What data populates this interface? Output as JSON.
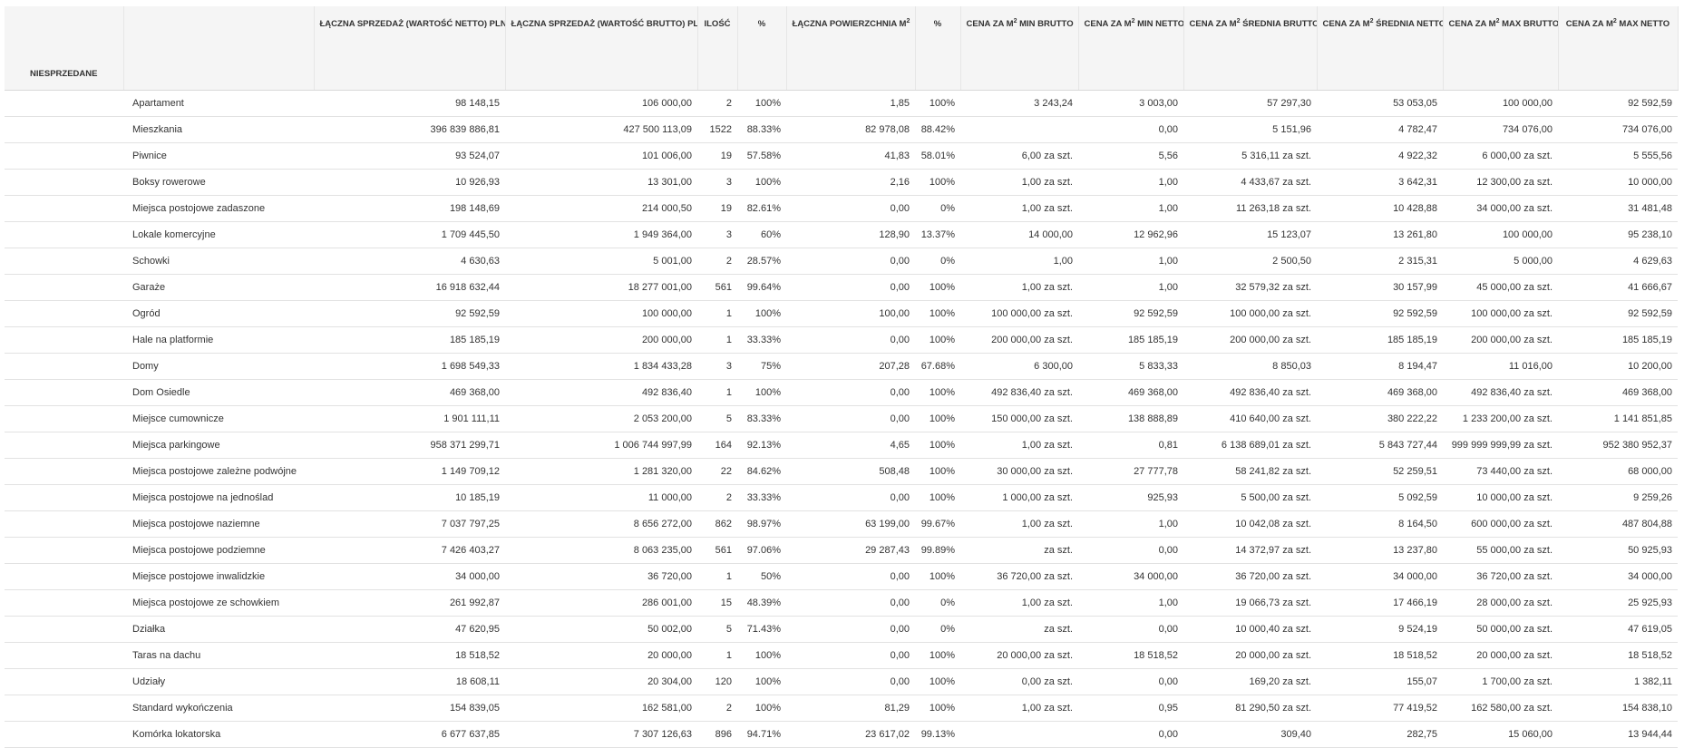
{
  "header": {
    "first": "NIESPRZEDANE",
    "cols": [
      {
        "pre": "ŁĄCZNA SPRZEDAŻ (WARTOŚĆ NETTO) PLN",
        "sup": "",
        "post": ""
      },
      {
        "pre": "ŁĄCZNA SPRZEDAŻ (WARTOŚĆ BRUTTO) PLN",
        "sup": "",
        "post": ""
      },
      {
        "pre": "ILOŚĆ",
        "sup": "",
        "post": ""
      },
      {
        "pre": "%",
        "sup": "",
        "post": ""
      },
      {
        "pre": "ŁĄCZNA POWIERZCHNIA M",
        "sup": "2",
        "post": ""
      },
      {
        "pre": "%",
        "sup": "",
        "post": ""
      },
      {
        "pre": "CENA ZA M",
        "sup": "2",
        "post": " MIN BRUTTO"
      },
      {
        "pre": "CENA ZA M",
        "sup": "2",
        "post": " MIN NETTO"
      },
      {
        "pre": "CENA ZA M",
        "sup": "2",
        "post": " ŚREDNIA BRUTTO"
      },
      {
        "pre": "CENA ZA M",
        "sup": "2",
        "post": " ŚREDNIA NETTO"
      },
      {
        "pre": "CENA ZA M",
        "sup": "2",
        "post": " MAX BRUTTO"
      },
      {
        "pre": "CENA ZA M",
        "sup": "2",
        "post": " MAX NETTO"
      }
    ]
  },
  "rows": [
    [
      "",
      "Apartament",
      "98 148,15",
      "106 000,00",
      "2",
      "100%",
      "1,85",
      "100%",
      "3 243,24",
      "3 003,00",
      "57 297,30",
      "53 053,05",
      "100 000,00",
      "92 592,59"
    ],
    [
      "",
      "Mieszkania",
      "396 839 886,81",
      "427 500 113,09",
      "1522",
      "88.33%",
      "82 978,08",
      "88.42%",
      "",
      "0,00",
      "5 151,96",
      "4 782,47",
      "734 076,00",
      "734 076,00"
    ],
    [
      "",
      "Piwnice",
      "93 524,07",
      "101 006,00",
      "19",
      "57.58%",
      "41,83",
      "58.01%",
      "6,00 za szt.",
      "5,56",
      "5 316,11 za szt.",
      "4 922,32",
      "6 000,00 za szt.",
      "5 555,56"
    ],
    [
      "",
      "Boksy rowerowe",
      "10 926,93",
      "13 301,00",
      "3",
      "100%",
      "2,16",
      "100%",
      "1,00 za szt.",
      "1,00",
      "4 433,67 za szt.",
      "3 642,31",
      "12 300,00 za szt.",
      "10 000,00"
    ],
    [
      "",
      "Miejsca postojowe zadaszone",
      "198 148,69",
      "214 000,50",
      "19",
      "82.61%",
      "0,00",
      "0%",
      "1,00 za szt.",
      "1,00",
      "11 263,18 za szt.",
      "10 428,88",
      "34 000,00 za szt.",
      "31 481,48"
    ],
    [
      "",
      "Lokale komercyjne",
      "1 709 445,50",
      "1 949 364,00",
      "3",
      "60%",
      "128,90",
      "13.37%",
      "14 000,00",
      "12 962,96",
      "15 123,07",
      "13 261,80",
      "100 000,00",
      "95 238,10"
    ],
    [
      "",
      "Schowki",
      "4 630,63",
      "5 001,00",
      "2",
      "28.57%",
      "0,00",
      "0%",
      "1,00",
      "1,00",
      "2 500,50",
      "2 315,31",
      "5 000,00",
      "4 629,63"
    ],
    [
      "",
      "Garaże",
      "16 918 632,44",
      "18 277 001,00",
      "561",
      "99.64%",
      "0,00",
      "100%",
      "1,00 za szt.",
      "1,00",
      "32 579,32 za szt.",
      "30 157,99",
      "45 000,00 za szt.",
      "41 666,67"
    ],
    [
      "",
      "Ogród",
      "92 592,59",
      "100 000,00",
      "1",
      "100%",
      "100,00",
      "100%",
      "100 000,00 za szt.",
      "92 592,59",
      "100 000,00 za szt.",
      "92 592,59",
      "100 000,00 za szt.",
      "92 592,59"
    ],
    [
      "",
      "Hale na platformie",
      "185 185,19",
      "200 000,00",
      "1",
      "33.33%",
      "0,00",
      "100%",
      "200 000,00 za szt.",
      "185 185,19",
      "200 000,00 za szt.",
      "185 185,19",
      "200 000,00 za szt.",
      "185 185,19"
    ],
    [
      "",
      "Domy",
      "1 698 549,33",
      "1 834 433,28",
      "3",
      "75%",
      "207,28",
      "67.68%",
      "6 300,00",
      "5 833,33",
      "8 850,03",
      "8 194,47",
      "11 016,00",
      "10 200,00"
    ],
    [
      "",
      "Dom Osiedle",
      "469 368,00",
      "492 836,40",
      "1",
      "100%",
      "0,00",
      "100%",
      "492 836,40 za szt.",
      "469 368,00",
      "492 836,40 za szt.",
      "469 368,00",
      "492 836,40 za szt.",
      "469 368,00"
    ],
    [
      "",
      "Miejsce cumownicze",
      "1 901 111,11",
      "2 053 200,00",
      "5",
      "83.33%",
      "0,00",
      "100%",
      "150 000,00 za szt.",
      "138 888,89",
      "410 640,00 za szt.",
      "380 222,22",
      "1 233 200,00 za szt.",
      "1 141 851,85"
    ],
    [
      "",
      "Miejsca parkingowe",
      "958 371 299,71",
      "1 006 744 997,99",
      "164",
      "92.13%",
      "4,65",
      "100%",
      "1,00 za szt.",
      "0,81",
      "6 138 689,01 za szt.",
      "5 843 727,44",
      "999 999 999,99 za szt.",
      "952 380 952,37"
    ],
    [
      "",
      "Miejsca postojowe zależne podwójne",
      "1 149 709,12",
      "1 281 320,00",
      "22",
      "84.62%",
      "508,48",
      "100%",
      "30 000,00 za szt.",
      "27 777,78",
      "58 241,82 za szt.",
      "52 259,51",
      "73 440,00 za szt.",
      "68 000,00"
    ],
    [
      "",
      "Miejsca postojowe na jednoślad",
      "10 185,19",
      "11 000,00",
      "2",
      "33.33%",
      "0,00",
      "100%",
      "1 000,00 za szt.",
      "925,93",
      "5 500,00 za szt.",
      "5 092,59",
      "10 000,00 za szt.",
      "9 259,26"
    ],
    [
      "",
      "Miejsca postojowe naziemne",
      "7 037 797,25",
      "8 656 272,00",
      "862",
      "98.97%",
      "63 199,00",
      "99.67%",
      "1,00 za szt.",
      "1,00",
      "10 042,08 za szt.",
      "8 164,50",
      "600 000,00 za szt.",
      "487 804,88"
    ],
    [
      "",
      "Miejsca postojowe podziemne",
      "7 426 403,27",
      "8 063 235,00",
      "561",
      "97.06%",
      "29 287,43",
      "99.89%",
      "za szt.",
      "0,00",
      "14 372,97 za szt.",
      "13 237,80",
      "55 000,00 za szt.",
      "50 925,93"
    ],
    [
      "",
      "Miejsce postojowe inwalidzkie",
      "34 000,00",
      "36 720,00",
      "1",
      "50%",
      "0,00",
      "100%",
      "36 720,00 za szt.",
      "34 000,00",
      "36 720,00 za szt.",
      "34 000,00",
      "36 720,00 za szt.",
      "34 000,00"
    ],
    [
      "",
      "Miejsca postojowe ze schowkiem",
      "261 992,87",
      "286 001,00",
      "15",
      "48.39%",
      "0,00",
      "0%",
      "1,00 za szt.",
      "1,00",
      "19 066,73 za szt.",
      "17 466,19",
      "28 000,00 za szt.",
      "25 925,93"
    ],
    [
      "",
      "Działka",
      "47 620,95",
      "50 002,00",
      "5",
      "71.43%",
      "0,00",
      "0%",
      "za szt.",
      "0,00",
      "10 000,40 za szt.",
      "9 524,19",
      "50 000,00 za szt.",
      "47 619,05"
    ],
    [
      "",
      "Taras na dachu",
      "18 518,52",
      "20 000,00",
      "1",
      "100%",
      "0,00",
      "100%",
      "20 000,00 za szt.",
      "18 518,52",
      "20 000,00 za szt.",
      "18 518,52",
      "20 000,00 za szt.",
      "18 518,52"
    ],
    [
      "",
      "Udziały",
      "18 608,11",
      "20 304,00",
      "120",
      "100%",
      "0,00",
      "100%",
      "0,00 za szt.",
      "0,00",
      "169,20 za szt.",
      "155,07",
      "1 700,00 za szt.",
      "1 382,11"
    ],
    [
      "",
      "Standard wykończenia",
      "154 839,05",
      "162 581,00",
      "2",
      "100%",
      "81,29",
      "100%",
      "1,00 za szt.",
      "0,95",
      "81 290,50 za szt.",
      "77 419,52",
      "162 580,00 za szt.",
      "154 838,10"
    ],
    [
      "",
      "Komórka lokatorska",
      "6 677 637,85",
      "7 307 126,63",
      "896",
      "94.71%",
      "23 617,02",
      "99.13%",
      "",
      "0,00",
      "309,40",
      "282,75",
      "15 060,00",
      "13 944,44"
    ]
  ]
}
